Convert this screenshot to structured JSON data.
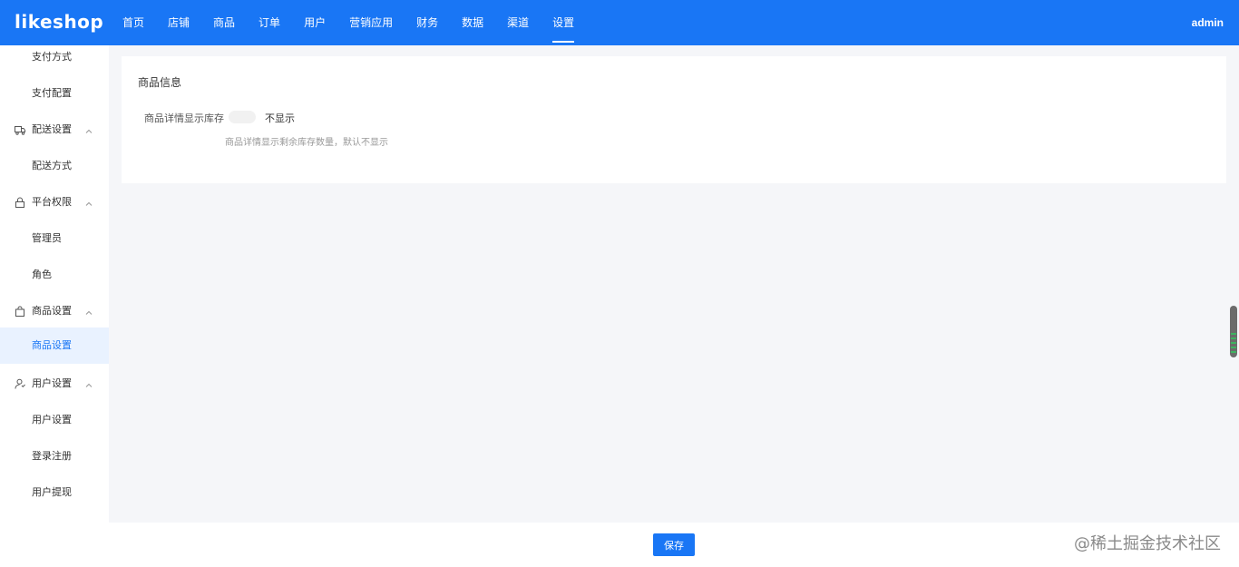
{
  "header": {
    "logo": "likeshop",
    "nav": [
      "首页",
      "店铺",
      "商品",
      "订单",
      "用户",
      "营销应用",
      "财务",
      "数据",
      "渠道",
      "设置"
    ],
    "active_nav": "设置",
    "user": "admin"
  },
  "sidebar": {
    "items": [
      {
        "label": "支付方式",
        "type": "sub"
      },
      {
        "label": "支付配置",
        "type": "sub"
      },
      {
        "label": "配送设置",
        "type": "group",
        "icon": "truck-icon"
      },
      {
        "label": "配送方式",
        "type": "sub"
      },
      {
        "label": "平台权限",
        "type": "group",
        "icon": "lock-icon"
      },
      {
        "label": "管理员",
        "type": "sub"
      },
      {
        "label": "角色",
        "type": "sub"
      },
      {
        "label": "商品设置",
        "type": "group",
        "icon": "bag-icon"
      },
      {
        "label": "商品设置",
        "type": "sub",
        "active": true
      },
      {
        "label": "用户设置",
        "type": "group",
        "icon": "user-icon"
      },
      {
        "label": "用户设置",
        "type": "sub"
      },
      {
        "label": "登录注册",
        "type": "sub"
      },
      {
        "label": "用户提现",
        "type": "sub"
      }
    ]
  },
  "main": {
    "section_title": "商品信息",
    "field_label": "商品详情显示库存",
    "switch_text": "不显示",
    "switch_on": false,
    "hint": "商品详情显示剩余库存数量，默认不显示"
  },
  "footer": {
    "save_label": "保存"
  },
  "watermark": "@稀土掘金技术社区",
  "colors": {
    "primary": "#1976f5",
    "sidebar_active_bg": "#e9f2ff",
    "page_bg": "#f5f6f9"
  }
}
